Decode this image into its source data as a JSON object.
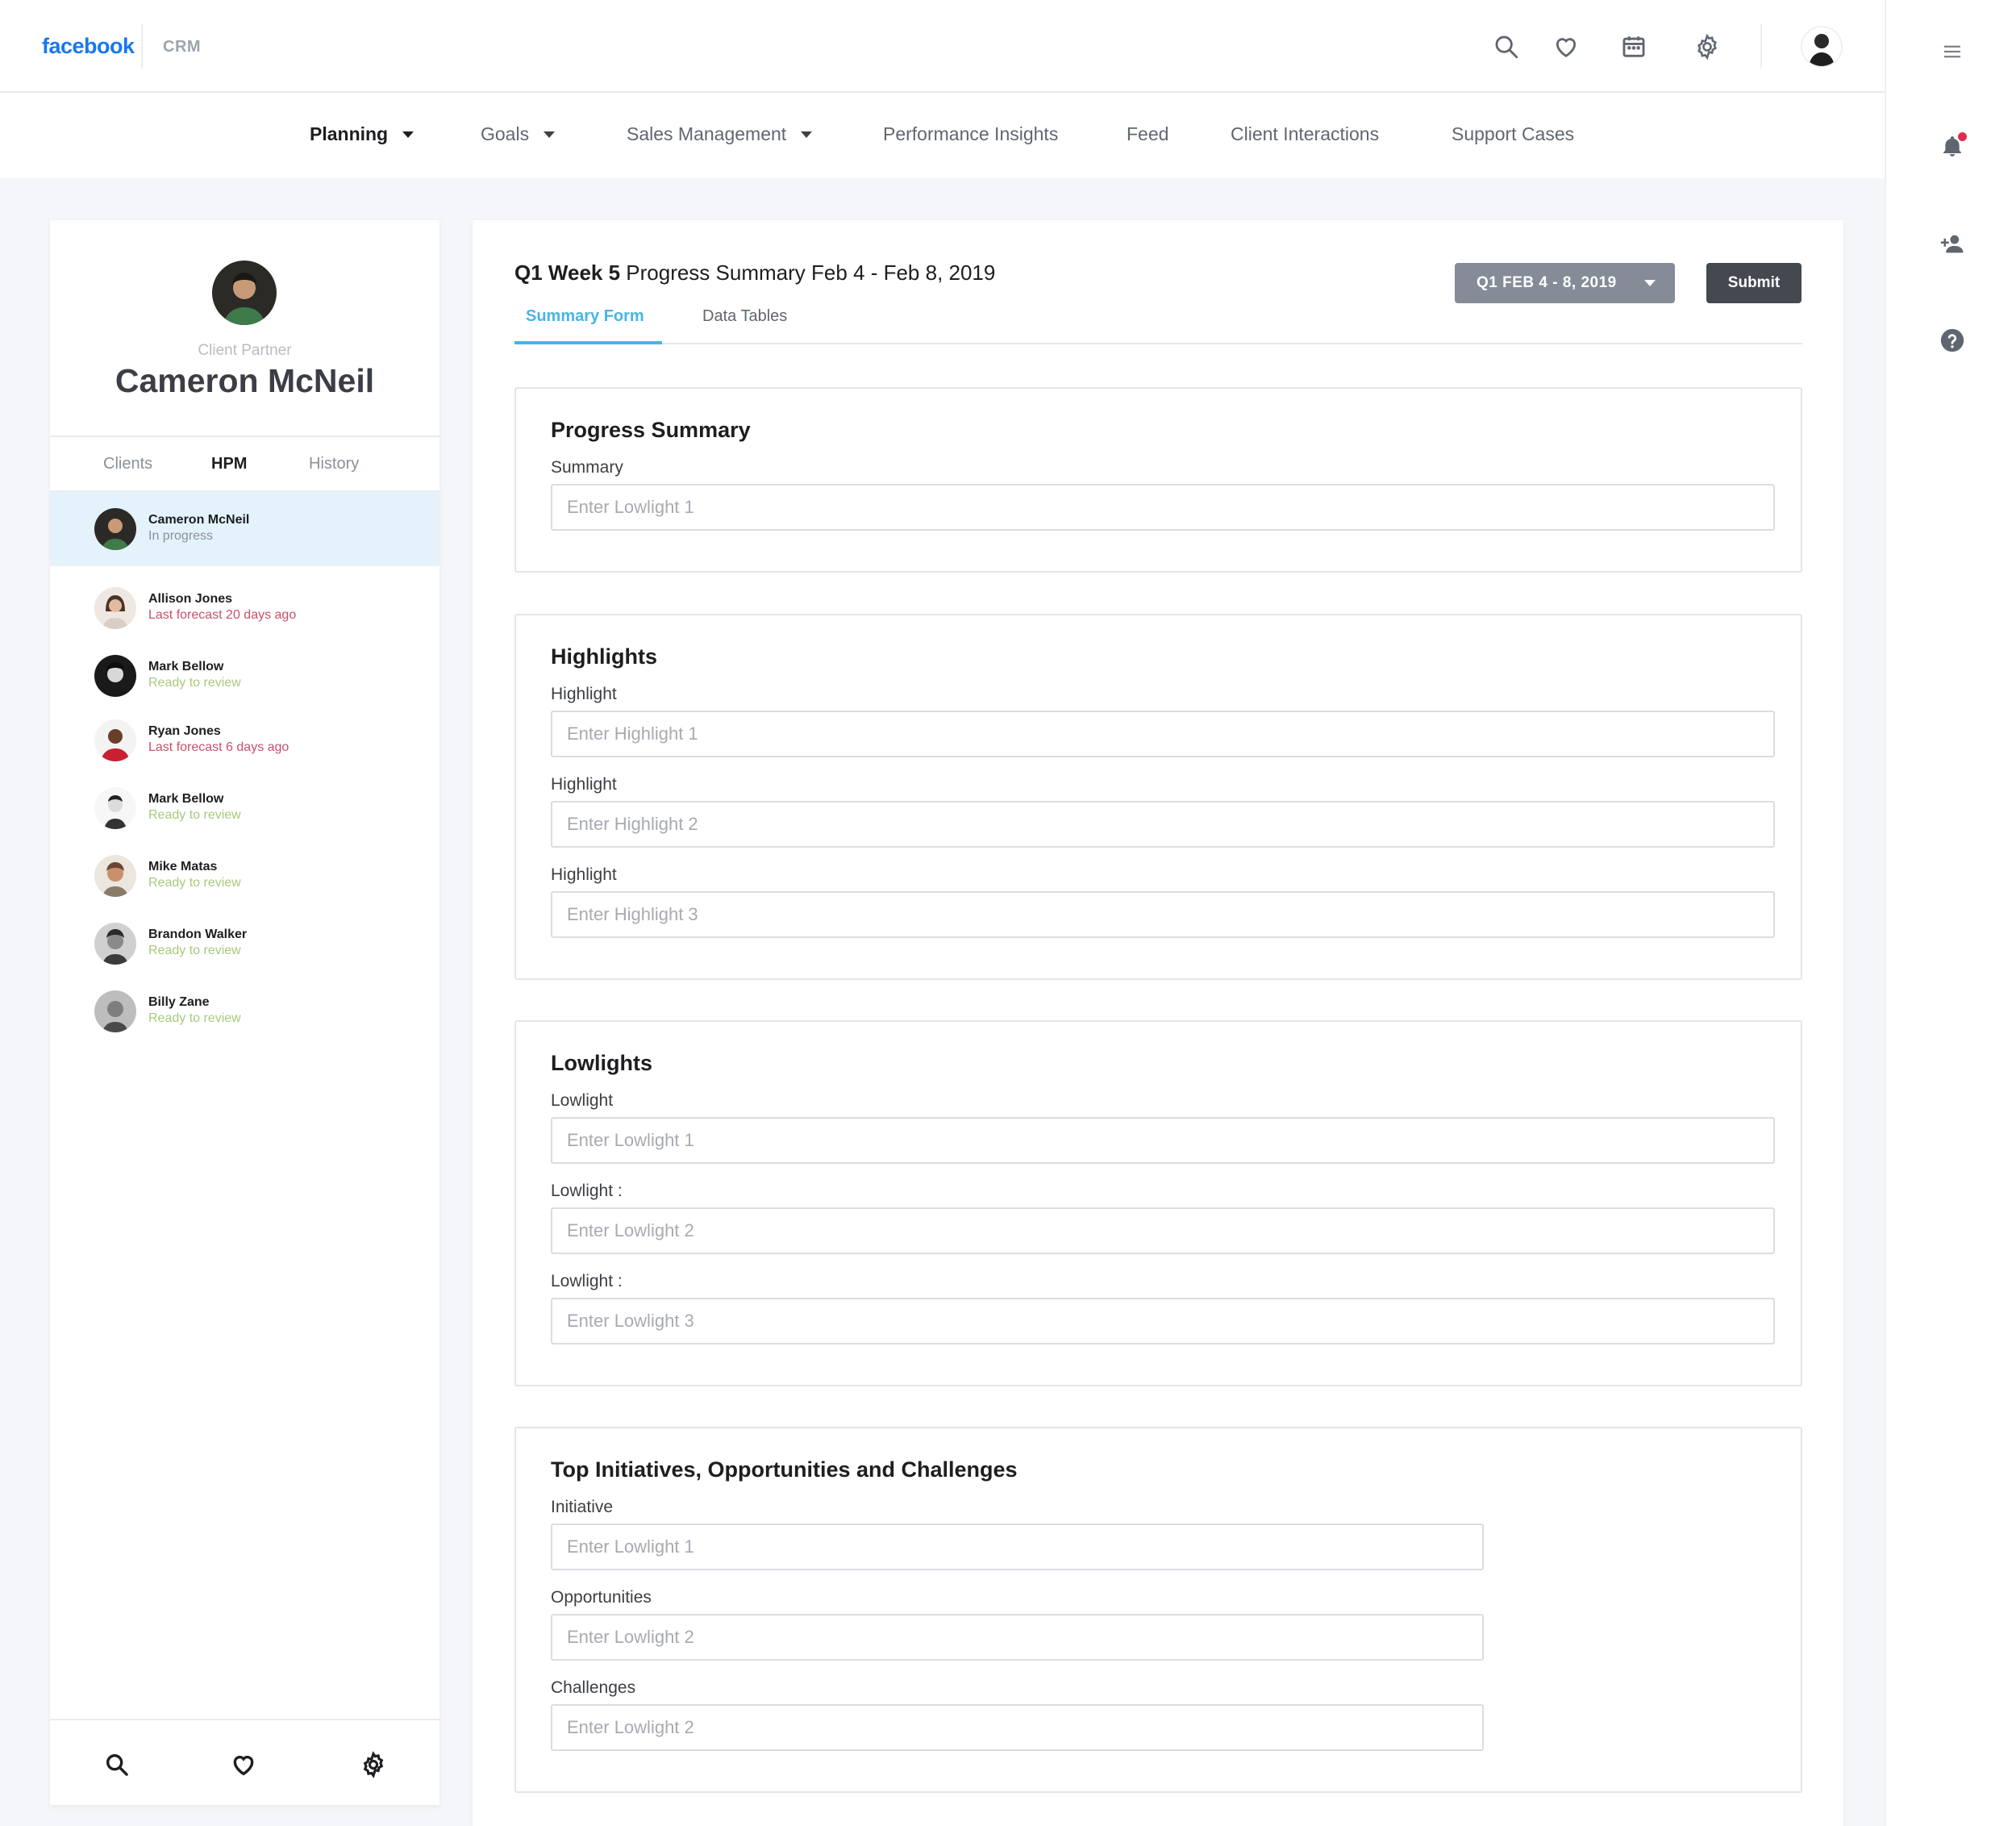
{
  "header": {
    "logo": "facebook",
    "app": "CRM"
  },
  "nav": {
    "items": [
      {
        "label": "Planning",
        "active": true,
        "dropdown": true
      },
      {
        "label": "Goals",
        "active": false,
        "dropdown": true
      },
      {
        "label": "Sales Management",
        "active": false,
        "dropdown": true
      },
      {
        "label": "Performance Insights",
        "active": false,
        "dropdown": false
      },
      {
        "label": "Feed",
        "active": false,
        "dropdown": false
      },
      {
        "label": "Client Interactions",
        "active": false,
        "dropdown": false
      },
      {
        "label": "Support Cases",
        "active": false,
        "dropdown": false
      }
    ]
  },
  "profile": {
    "role": "Client Partner",
    "name": "Cameron McNeil",
    "tabs": [
      "Clients",
      "HPM",
      "History"
    ],
    "active_tab": "HPM"
  },
  "people": [
    {
      "name": "Cameron McNeil",
      "status": "In progress",
      "status_type": "neutral",
      "selected": true
    },
    {
      "name": "Allison Jones",
      "status": "Last forecast 20 days ago",
      "status_type": "alert",
      "selected": false
    },
    {
      "name": "Mark Bellow",
      "status": "Ready to review",
      "status_type": "ready",
      "selected": false
    },
    {
      "name": "Ryan Jones",
      "status": "Last forecast 6 days ago",
      "status_type": "alert",
      "selected": false
    },
    {
      "name": "Mark Bellow",
      "status": "Ready to review",
      "status_type": "ready",
      "selected": false
    },
    {
      "name": "Mike Matas",
      "status": "Ready to review",
      "status_type": "ready",
      "selected": false
    },
    {
      "name": "Brandon Walker",
      "status": "Ready to review",
      "status_type": "ready",
      "selected": false
    },
    {
      "name": "Billy Zane",
      "status": "Ready to review",
      "status_type": "ready",
      "selected": false
    }
  ],
  "status_colors": {
    "neutral": "#8a9099",
    "alert": "#c8506a",
    "ready": "#a8c97e"
  },
  "main": {
    "title_bold": "Q1 Week 5",
    "title_rest": " Progress Summary Feb 4 - Feb 8, 2019",
    "week_selector": "Q1 FEB 4 - 8, 2019",
    "submit_label": "Submit",
    "tabs": [
      "Summary Form",
      "Data Tables"
    ],
    "active_tab": "Summary Form"
  },
  "sections": [
    {
      "title": "Progress Summary",
      "fields": [
        {
          "label": "Summary",
          "placeholder": "Enter Lowlight 1",
          "value": ""
        }
      ]
    },
    {
      "title": "Highlights",
      "fields": [
        {
          "label": "Highlight",
          "placeholder": "Enter Highlight 1",
          "value": ""
        },
        {
          "label": "Highlight",
          "placeholder": "Enter Highlight 2",
          "value": ""
        },
        {
          "label": "Highlight",
          "placeholder": "Enter Highlight 3",
          "value": ""
        }
      ]
    },
    {
      "title": "Lowlights",
      "fields": [
        {
          "label": "Lowlight",
          "placeholder": "Enter Lowlight 1",
          "value": ""
        },
        {
          "label": "Lowlight :",
          "placeholder": "Enter Lowlight 2",
          "value": ""
        },
        {
          "label": "Lowlight :",
          "placeholder": "Enter Lowlight 3",
          "value": ""
        }
      ]
    },
    {
      "title": "Top Initiatives, Opportunities and Challenges",
      "fields": [
        {
          "label": "Initiative",
          "placeholder": "Enter Lowlight 1",
          "value": ""
        },
        {
          "label": "Opportunities",
          "placeholder": "Enter Lowlight 2",
          "value": ""
        },
        {
          "label": "Challenges",
          "placeholder": "Enter Lowlight 2",
          "value": ""
        }
      ]
    }
  ],
  "icons": {
    "header": [
      "search-icon",
      "heart-icon",
      "calendar-icon",
      "gear-icon"
    ],
    "rail": [
      "menu-icon",
      "bell-icon",
      "add-person-icon",
      "help-icon"
    ],
    "left_bottom": [
      "search-icon",
      "heart-icon",
      "gear-icon"
    ]
  },
  "colors": {
    "brand": "#1877f2",
    "accent_tab": "#45b5e8",
    "notification": "#e02d4f",
    "selected_row": "#e4f2fc"
  }
}
